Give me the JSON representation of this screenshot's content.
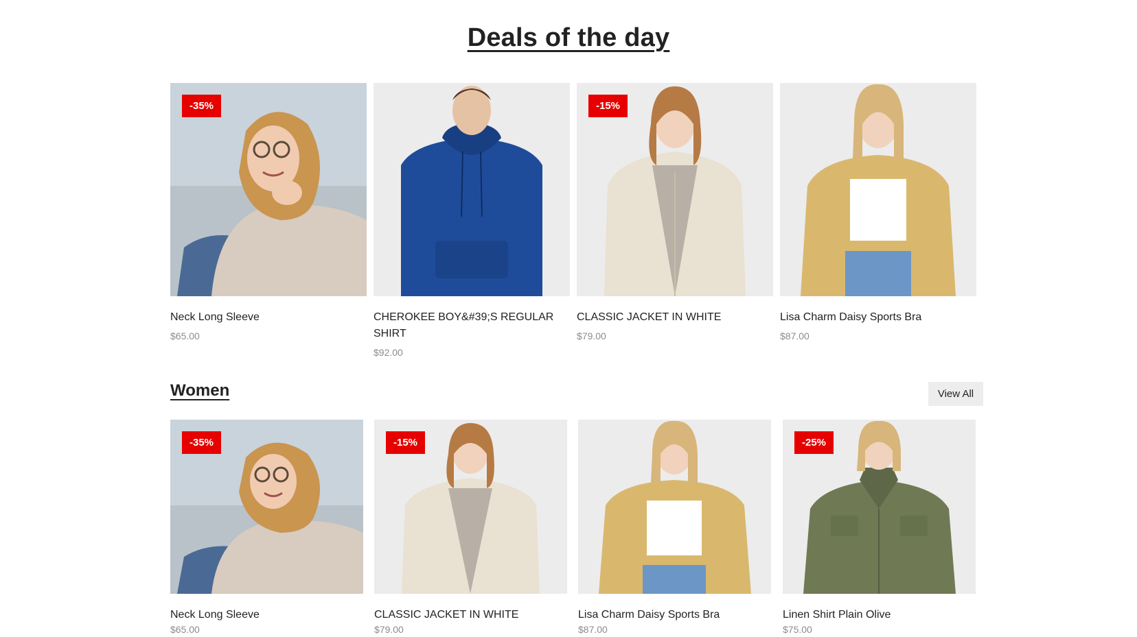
{
  "deals": {
    "title": "Deals of the day",
    "products": [
      {
        "name": "Neck Long Sleeve",
        "price": "$65.00",
        "badge": "-35%",
        "image": "woman-sweater-sunglasses"
      },
      {
        "name": "CHEROKEE BOY&#39;S REGULAR SHIRT",
        "price": "$92.00",
        "badge": "",
        "image": "man-blue-hoodie"
      },
      {
        "name": "CLASSIC JACKET IN WHITE",
        "price": "$79.00",
        "badge": "-15%",
        "image": "woman-white-jacket"
      },
      {
        "name": "Lisa Charm Daisy Sports Bra",
        "price": "$87.00",
        "badge": "",
        "image": "woman-yellow-cardigan"
      }
    ]
  },
  "women": {
    "title": "Women",
    "view_all_label": "View All",
    "products": [
      {
        "name": "Neck Long Sleeve",
        "price": "$65.00",
        "badge": "-35%",
        "image": "woman-sweater-sunglasses"
      },
      {
        "name": "CLASSIC JACKET IN WHITE",
        "price": "$79.00",
        "badge": "-15%",
        "image": "woman-white-jacket"
      },
      {
        "name": "Lisa Charm Daisy Sports Bra",
        "price": "$87.00",
        "badge": "",
        "image": "woman-yellow-cardigan"
      },
      {
        "name": "Linen Shirt Plain Olive",
        "price": "$75.00",
        "badge": "-25%",
        "image": "woman-olive-jacket"
      }
    ]
  },
  "colors": {
    "badge_bg": "#e60000",
    "image_bg": "#ececec",
    "price": "#8b8b8b",
    "button_bg": "#ededed"
  }
}
